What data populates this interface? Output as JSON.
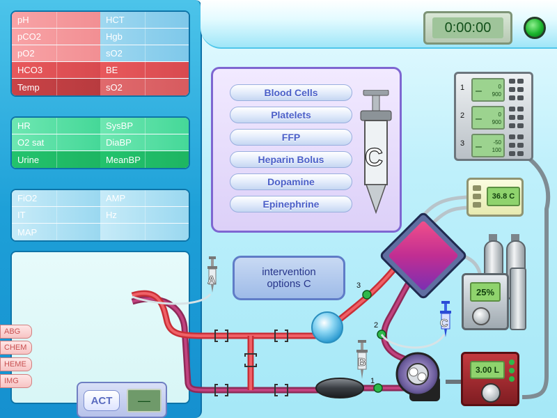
{
  "blood_gas_panel": {
    "rows": [
      {
        "left": "pH",
        "right": "HCT"
      },
      {
        "left": "pCO2",
        "right": "Hgb"
      },
      {
        "left": "pO2",
        "right": "sO2"
      },
      {
        "left": "HCO3",
        "right": "BE"
      },
      {
        "left": "Temp",
        "right": "sO2"
      }
    ]
  },
  "vitals_panel": {
    "rows": [
      {
        "left": "HR",
        "right": "SysBP"
      },
      {
        "left": "O2 sat",
        "right": "DiaBP"
      },
      {
        "left": "Urine",
        "right": "MeanBP"
      }
    ]
  },
  "ventilator_panel": {
    "rows": [
      {
        "left": "FiO2",
        "right": "AMP"
      },
      {
        "left": "IT",
        "right": "Hz"
      },
      {
        "left": "MAP",
        "right": ""
      }
    ]
  },
  "lab_tabs": [
    "ABG",
    "CHEM",
    "HEME",
    "IMG"
  ],
  "act": {
    "label": "ACT",
    "value": "—"
  },
  "timer": {
    "value": "0:00:00"
  },
  "interventions": {
    "buttons": [
      "Blood Cells",
      "Platelets",
      "FFP",
      "Heparin Bolus",
      "Dopamine",
      "Epinephrine"
    ],
    "syringe_label": "C"
  },
  "intervention_options": {
    "line1": "intervention",
    "line2": "options C"
  },
  "pumps": [
    {
      "num": "1",
      "display": "–",
      "v1": "0",
      "v2": "900"
    },
    {
      "num": "2",
      "display": "–",
      "v1": "0",
      "v2": "900"
    },
    {
      "num": "3",
      "display": "–",
      "v1": "-50",
      "v2": "100"
    }
  ],
  "temperature": {
    "value": "36.8 C"
  },
  "gas_blender": {
    "value": "25%"
  },
  "flow": {
    "value": "3.00 L"
  },
  "ports": {
    "a": "A",
    "b": "B",
    "c": "C"
  },
  "connectors": {
    "c1": "1",
    "c2": "2",
    "c3": "3"
  },
  "colors": {
    "arterial": "#e3444a",
    "venous": "#a12e63",
    "panel_blue": "#1ea0d8",
    "intervention_purple": "#7e66d1"
  }
}
